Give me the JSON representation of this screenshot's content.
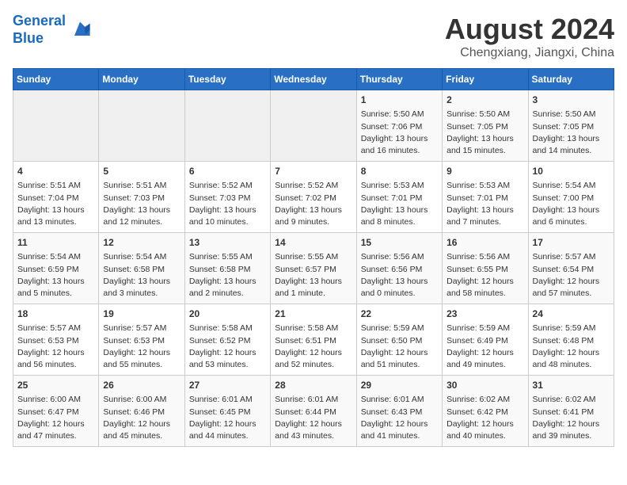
{
  "logo": {
    "line1": "General",
    "line2": "Blue"
  },
  "title": "August 2024",
  "subtitle": "Chengxiang, Jiangxi, China",
  "days_of_week": [
    "Sunday",
    "Monday",
    "Tuesday",
    "Wednesday",
    "Thursday",
    "Friday",
    "Saturday"
  ],
  "weeks": [
    [
      {
        "num": "",
        "info": ""
      },
      {
        "num": "",
        "info": ""
      },
      {
        "num": "",
        "info": ""
      },
      {
        "num": "",
        "info": ""
      },
      {
        "num": "1",
        "info": "Sunrise: 5:50 AM\nSunset: 7:06 PM\nDaylight: 13 hours\nand 16 minutes."
      },
      {
        "num": "2",
        "info": "Sunrise: 5:50 AM\nSunset: 7:05 PM\nDaylight: 13 hours\nand 15 minutes."
      },
      {
        "num": "3",
        "info": "Sunrise: 5:50 AM\nSunset: 7:05 PM\nDaylight: 13 hours\nand 14 minutes."
      }
    ],
    [
      {
        "num": "4",
        "info": "Sunrise: 5:51 AM\nSunset: 7:04 PM\nDaylight: 13 hours\nand 13 minutes."
      },
      {
        "num": "5",
        "info": "Sunrise: 5:51 AM\nSunset: 7:03 PM\nDaylight: 13 hours\nand 12 minutes."
      },
      {
        "num": "6",
        "info": "Sunrise: 5:52 AM\nSunset: 7:03 PM\nDaylight: 13 hours\nand 10 minutes."
      },
      {
        "num": "7",
        "info": "Sunrise: 5:52 AM\nSunset: 7:02 PM\nDaylight: 13 hours\nand 9 minutes."
      },
      {
        "num": "8",
        "info": "Sunrise: 5:53 AM\nSunset: 7:01 PM\nDaylight: 13 hours\nand 8 minutes."
      },
      {
        "num": "9",
        "info": "Sunrise: 5:53 AM\nSunset: 7:01 PM\nDaylight: 13 hours\nand 7 minutes."
      },
      {
        "num": "10",
        "info": "Sunrise: 5:54 AM\nSunset: 7:00 PM\nDaylight: 13 hours\nand 6 minutes."
      }
    ],
    [
      {
        "num": "11",
        "info": "Sunrise: 5:54 AM\nSunset: 6:59 PM\nDaylight: 13 hours\nand 5 minutes."
      },
      {
        "num": "12",
        "info": "Sunrise: 5:54 AM\nSunset: 6:58 PM\nDaylight: 13 hours\nand 3 minutes."
      },
      {
        "num": "13",
        "info": "Sunrise: 5:55 AM\nSunset: 6:58 PM\nDaylight: 13 hours\nand 2 minutes."
      },
      {
        "num": "14",
        "info": "Sunrise: 5:55 AM\nSunset: 6:57 PM\nDaylight: 13 hours\nand 1 minute."
      },
      {
        "num": "15",
        "info": "Sunrise: 5:56 AM\nSunset: 6:56 PM\nDaylight: 13 hours\nand 0 minutes."
      },
      {
        "num": "16",
        "info": "Sunrise: 5:56 AM\nSunset: 6:55 PM\nDaylight: 12 hours\nand 58 minutes."
      },
      {
        "num": "17",
        "info": "Sunrise: 5:57 AM\nSunset: 6:54 PM\nDaylight: 12 hours\nand 57 minutes."
      }
    ],
    [
      {
        "num": "18",
        "info": "Sunrise: 5:57 AM\nSunset: 6:53 PM\nDaylight: 12 hours\nand 56 minutes."
      },
      {
        "num": "19",
        "info": "Sunrise: 5:57 AM\nSunset: 6:53 PM\nDaylight: 12 hours\nand 55 minutes."
      },
      {
        "num": "20",
        "info": "Sunrise: 5:58 AM\nSunset: 6:52 PM\nDaylight: 12 hours\nand 53 minutes."
      },
      {
        "num": "21",
        "info": "Sunrise: 5:58 AM\nSunset: 6:51 PM\nDaylight: 12 hours\nand 52 minutes."
      },
      {
        "num": "22",
        "info": "Sunrise: 5:59 AM\nSunset: 6:50 PM\nDaylight: 12 hours\nand 51 minutes."
      },
      {
        "num": "23",
        "info": "Sunrise: 5:59 AM\nSunset: 6:49 PM\nDaylight: 12 hours\nand 49 minutes."
      },
      {
        "num": "24",
        "info": "Sunrise: 5:59 AM\nSunset: 6:48 PM\nDaylight: 12 hours\nand 48 minutes."
      }
    ],
    [
      {
        "num": "25",
        "info": "Sunrise: 6:00 AM\nSunset: 6:47 PM\nDaylight: 12 hours\nand 47 minutes."
      },
      {
        "num": "26",
        "info": "Sunrise: 6:00 AM\nSunset: 6:46 PM\nDaylight: 12 hours\nand 45 minutes."
      },
      {
        "num": "27",
        "info": "Sunrise: 6:01 AM\nSunset: 6:45 PM\nDaylight: 12 hours\nand 44 minutes."
      },
      {
        "num": "28",
        "info": "Sunrise: 6:01 AM\nSunset: 6:44 PM\nDaylight: 12 hours\nand 43 minutes."
      },
      {
        "num": "29",
        "info": "Sunrise: 6:01 AM\nSunset: 6:43 PM\nDaylight: 12 hours\nand 41 minutes."
      },
      {
        "num": "30",
        "info": "Sunrise: 6:02 AM\nSunset: 6:42 PM\nDaylight: 12 hours\nand 40 minutes."
      },
      {
        "num": "31",
        "info": "Sunrise: 6:02 AM\nSunset: 6:41 PM\nDaylight: 12 hours\nand 39 minutes."
      }
    ]
  ]
}
